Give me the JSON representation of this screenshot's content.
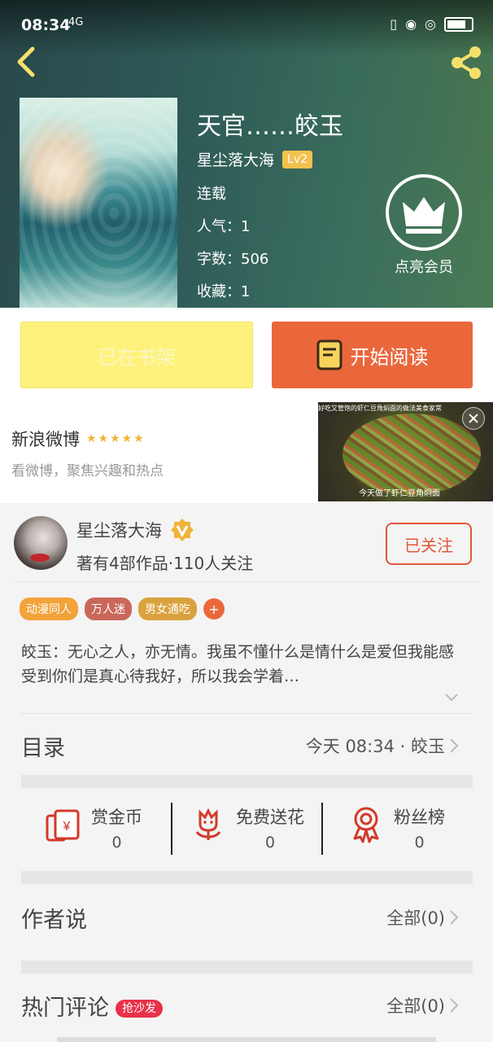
{
  "status_bar": {
    "time": "08:34",
    "network": "4G"
  },
  "book": {
    "title": "天官……皎玉",
    "author": "星尘落大海",
    "level": "Lv2",
    "status": "连载",
    "popularity_label": "人气：",
    "popularity": "1",
    "word_count_label": "字数：",
    "word_count": "506",
    "favorites_label": "收藏：",
    "favorites": "1"
  },
  "vip": {
    "label": "点亮会员"
  },
  "actions": {
    "shelf_label": "已在书架",
    "read_label": "开始阅读"
  },
  "ad": {
    "name": "新浪微博",
    "stars": "★★★★★",
    "description": "看微博，聚焦兴趣和热点",
    "image_text": "好吃又管饱的虾仁豆角焖面的做法美食家常",
    "image_caption": "今天做了虾仁豆角焖面"
  },
  "author_card": {
    "name": "星尘落大海",
    "stats": "著有4部作品·110人关注",
    "follow_label": "已关注",
    "tags": [
      "动漫同人",
      "万人迷",
      "男女通吃"
    ],
    "tag_add": "+",
    "intro": "皎玉：无心之人，亦无情。我虽不懂什么是情什么是爱但我能感受到你们是真心待我好，所以我会学着…"
  },
  "catalog": {
    "title": "目录",
    "latest": "今天 08:34 · 皎玉"
  },
  "rewards": [
    {
      "label": "赏金币",
      "value": "0",
      "icon": "coin-icon"
    },
    {
      "label": "免费送花",
      "value": "0",
      "icon": "flower-icon"
    },
    {
      "label": "粉丝榜",
      "value": "0",
      "icon": "medal-icon"
    }
  ],
  "author_says": {
    "title": "作者说",
    "right": "全部(0)"
  },
  "hot_comments": {
    "title": "热门评论",
    "badge": "抢沙发",
    "right": "全部(0)"
  },
  "colors": {
    "accent": "#ea673c",
    "shelf_yellow": "#fef27c",
    "follow_red": "#e2573a",
    "tag_colors": [
      "#f2a33a",
      "#c9685a",
      "#d9a23d"
    ],
    "sofa_badge": "#e9314a"
  }
}
